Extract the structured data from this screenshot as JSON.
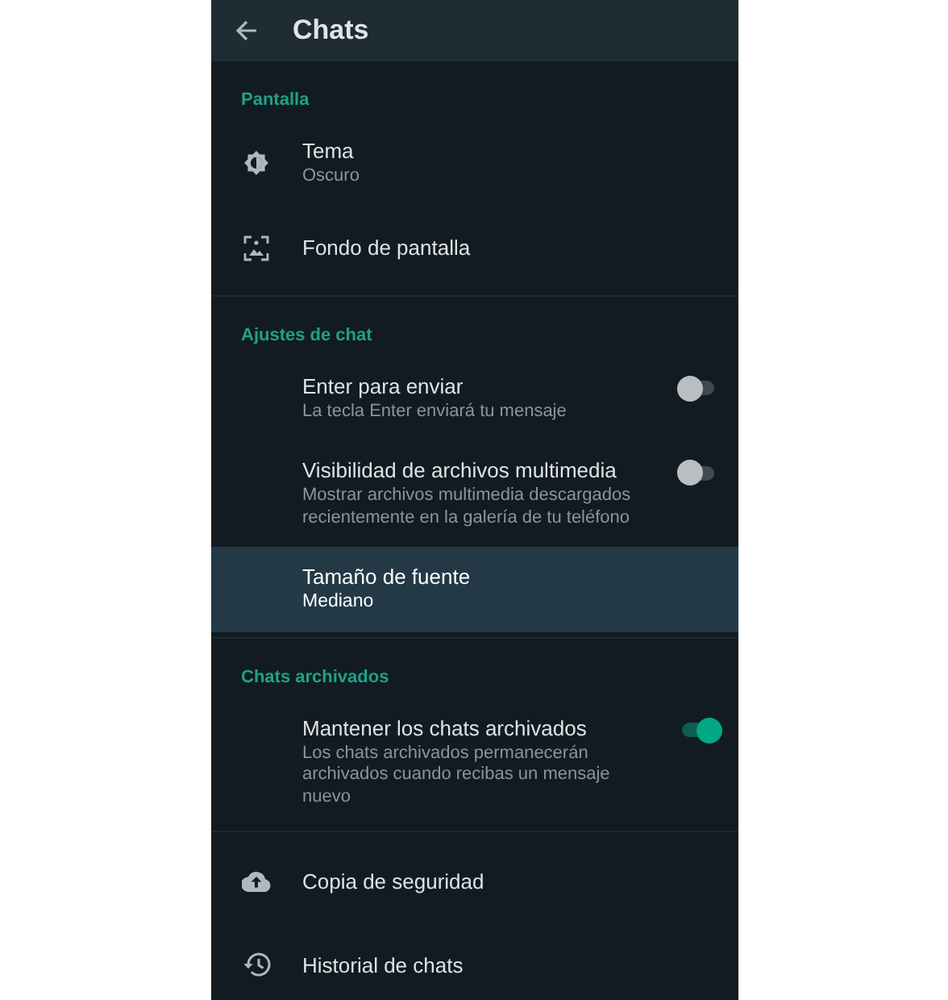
{
  "header": {
    "title": "Chats"
  },
  "sections": [
    {
      "title": "Pantalla",
      "items": [
        {
          "kind": "brightness",
          "title": "Tema",
          "subtitle": "Oscuro",
          "selected": false
        },
        {
          "kind": "wallpaper",
          "title": "Fondo de pantalla",
          "selected": false
        }
      ]
    },
    {
      "title": "Ajustes de chat",
      "items": [
        {
          "kind": "switch",
          "title": "Enter para enviar",
          "subtitle": "La tecla Enter enviará tu mensaje",
          "on": false,
          "selected": false
        },
        {
          "kind": "switch",
          "title": "Visibilidad de archivos multimedia",
          "subtitle": "Mostrar archivos multimedia descargados recientemente en la galería de tu teléfono",
          "on": false,
          "selected": false
        },
        {
          "kind": "plain",
          "title": "Tamaño de fuente",
          "subtitle": "Mediano",
          "selected": true
        }
      ]
    },
    {
      "title": "Chats archivados",
      "items": [
        {
          "kind": "switch",
          "title": "Mantener los chats archivados",
          "subtitle": "Los chats archivados permanecerán archivados cuando recibas un mensaje nuevo",
          "on": true,
          "selected": false
        }
      ]
    },
    {
      "items": [
        {
          "kind": "backup",
          "title": "Copia de seguridad",
          "selected": false
        },
        {
          "kind": "history",
          "title": "Historial de chats",
          "selected": false
        }
      ]
    }
  ]
}
